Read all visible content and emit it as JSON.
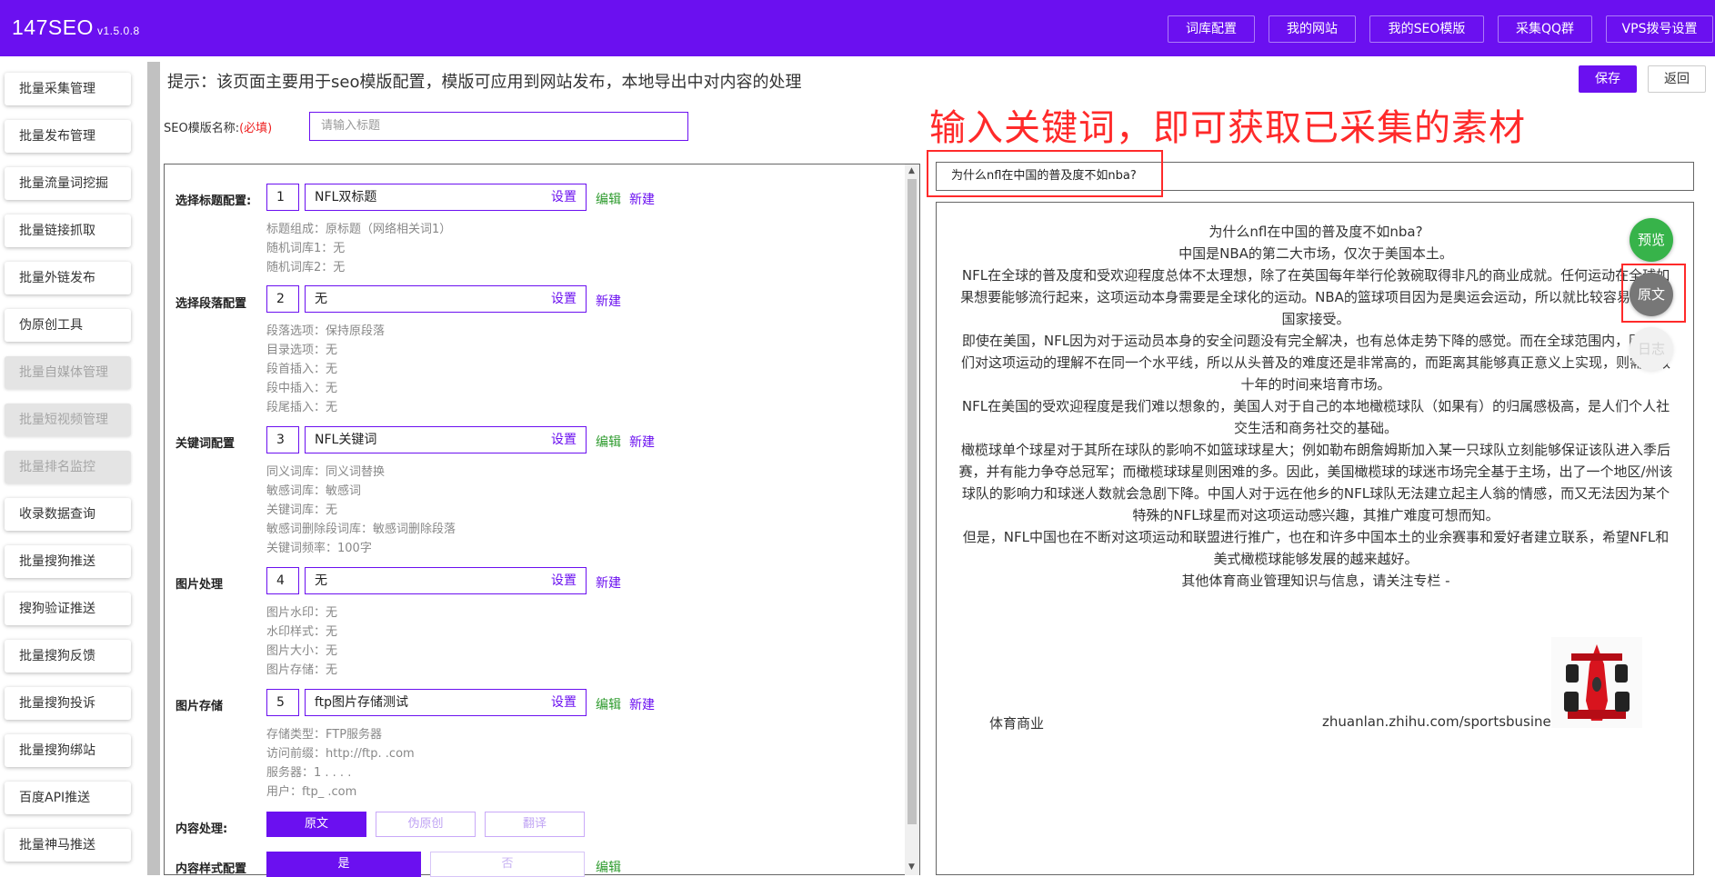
{
  "app": {
    "name": "147SEO",
    "version": "v1.5.0.8"
  },
  "topnav": [
    "词库配置",
    "我的网站",
    "我的SEO模版",
    "采集QQ群",
    "VPS拨号设置"
  ],
  "sidebar": [
    {
      "label": "批量采集管理",
      "disabled": false
    },
    {
      "label": "批量发布管理",
      "disabled": false
    },
    {
      "label": "批量流量词挖掘",
      "disabled": false
    },
    {
      "label": "批量链接抓取",
      "disabled": false
    },
    {
      "label": "批量外链发布",
      "disabled": false
    },
    {
      "label": "伪原创工具",
      "disabled": false
    },
    {
      "label": "批量自媒体管理",
      "disabled": true
    },
    {
      "label": "批量短视频管理",
      "disabled": true
    },
    {
      "label": "批量排名监控",
      "disabled": true
    },
    {
      "label": "收录数据查询",
      "disabled": false
    },
    {
      "label": "批量搜狗推送",
      "disabled": false
    },
    {
      "label": "搜狗验证推送",
      "disabled": false
    },
    {
      "label": "批量搜狗反馈",
      "disabled": false
    },
    {
      "label": "批量搜狗投诉",
      "disabled": false
    },
    {
      "label": "批量搜狗绑站",
      "disabled": false
    },
    {
      "label": "百度API推送",
      "disabled": false
    },
    {
      "label": "批量神马推送",
      "disabled": false
    }
  ],
  "page": {
    "tip": "提示：该页面主要用于seo模版配置，模版可应用到网站发布，本地导出中对内容的处理",
    "save_label": "保存",
    "back_label": "返回",
    "name_label": "SEO模版名称:",
    "name_required": "(必填)",
    "name_placeholder": "请输入标题"
  },
  "config": {
    "title": {
      "label": "选择标题配置:",
      "num": "1",
      "value": "NFL双标题",
      "set": "设置",
      "edit": "编辑",
      "new": "新建",
      "details": [
        "标题组成：原标题（网络相关词1）",
        "随机词库1：无",
        "随机词库2：无"
      ]
    },
    "paragraph": {
      "label": "选择段落配置",
      "num": "2",
      "value": "无",
      "set": "设置",
      "new": "新建",
      "details": [
        "段落选项：保持原段落",
        "目录选项：无",
        "段首插入：无",
        "段中插入：无",
        "段尾插入：无"
      ]
    },
    "keyword": {
      "label": "关键词配置",
      "num": "3",
      "value": "NFL关键词",
      "set": "设置",
      "edit": "编辑",
      "new": "新建",
      "details": [
        "同义词库：同义词替换",
        "敏感词库：敏感词",
        "关键词库：无",
        "敏感词删除段词库：敏感词删除段落",
        "关键词频率：100字"
      ]
    },
    "image": {
      "label": "图片处理",
      "num": "4",
      "value": "无",
      "set": "设置",
      "new": "新建",
      "details": [
        "图片水印：无",
        "水印样式：无",
        "图片大小：无",
        "图片存储：无"
      ]
    },
    "storage": {
      "label": "图片存储",
      "num": "5",
      "value": "ftp图片存储测试",
      "set": "设置",
      "edit": "编辑",
      "new": "新建",
      "details": [
        "存储类型：FTP服务器",
        "访问前缀：http://ftp.        .com",
        "服务器：1      .      .  .  .",
        "用户：ftp_          .com"
      ]
    },
    "content": {
      "label": "内容处理:",
      "options": [
        "原文",
        "伪原创",
        "翻译"
      ]
    },
    "style": {
      "label": "内容样式配置",
      "options": [
        "是",
        "否"
      ],
      "edit": "编辑"
    }
  },
  "annotation": "输入关键词，即可获取已采集的素材",
  "keyword_input": "为什么nfl在中国的普及度不如nba?",
  "preview": {
    "paragraphs": [
      "为什么nfl在中国的普及度不如nba?",
      "中国是NBA的第二大市场，仅次于美国本土。",
      "NFL在全球的普及度和受欢迎程度总体不太理想，除了在英国每年举行伦敦碗取得非凡的商业成就。任何运动在全球如果想要能够流行起来，这项运动本身需要是全球化的运动。NBA的篮球项目因为是奥运会运动，所以就比较容易被各个国家接受。",
      "即使在美国，NFL因为对于运动员本身的安全问题没有完全解决，也有总体走势下降的感觉。而在全球范围内，因为人们对这项运动的理解不在同一个水平线，所以从头普及的难度还是非常高的，而距离其能够真正意义上实现，则需要数十年的时间来培育市场。",
      "NFL在美国的受欢迎程度是我们难以想象的，美国人对于自己的本地橄榄球队（如果有）的归属感极高，是人们个人社交生活和商务社交的基础。",
      "橄榄球单个球星对于其所在球队的影响不如篮球球星大；例如勒布朗詹姆斯加入某一只球队立刻能够保证该队进入季后赛，并有能力争夺总冠军；而橄榄球球星则困难的多。因此，美国橄榄球的球迷市场完全基于主场，出了一个地区/州该球队的影响力和球迷人数就会急剧下降。中国人对于远在他乡的NFL球队无法建立起主人翁的情感，而又无法因为某个特殊的NFL球星而对这项运动感兴趣，其推广难度可想而知。",
      "但是，NFL中国也在不断对这项运动和联盟进行推广，也在和许多中国本土的业余赛事和爱好者建立联系，希望NFL和美式橄榄球能够发展的越来越好。",
      "其他体育商业管理知识与信息，请关注专栏 -"
    ],
    "footer_left": "体育商业",
    "footer_right": "zhuanlan.zhihu.com/sportsbusiness"
  },
  "fab": {
    "preview": "预览",
    "original": "原文",
    "log": "日志"
  },
  "colors": {
    "brand": "#6b10f0",
    "annotation": "#ff2a2a",
    "edit": "#2e9b2e",
    "preview_fab": "#37b34a"
  }
}
